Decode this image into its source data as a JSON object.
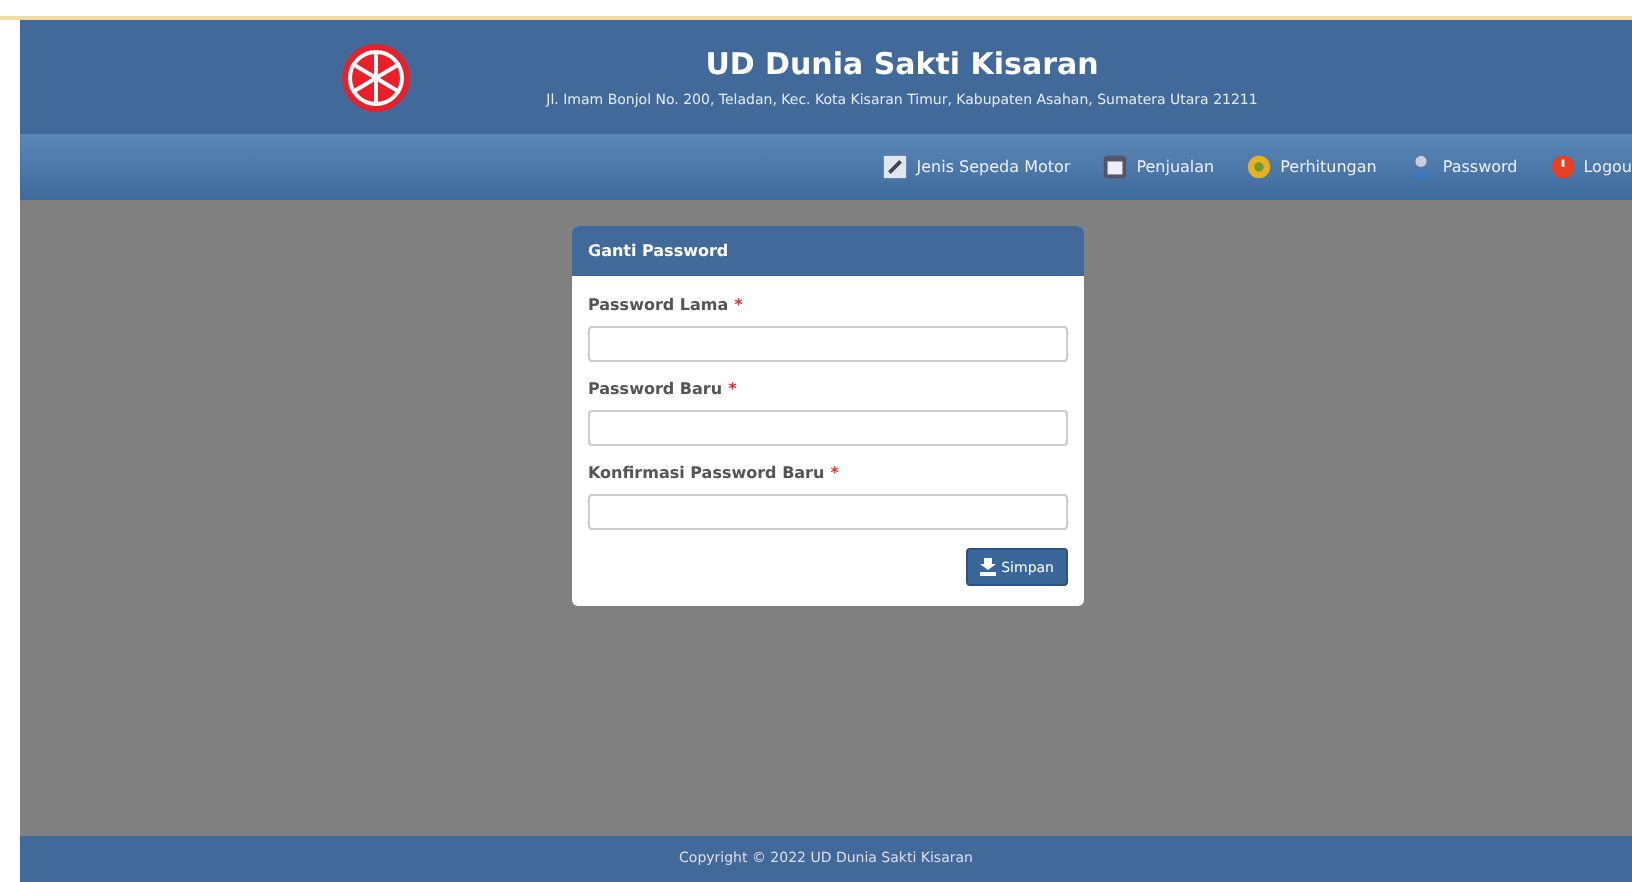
{
  "header": {
    "title": "UD Dunia Sakti Kisaran",
    "address": "Jl. Imam Bonjol No. 200, Teladan, Kec. Kota Kisaran Timur, Kabupaten Asahan, Sumatera Utara 21211"
  },
  "nav": [
    {
      "label": "Jenis Sepeda Motor",
      "kind": "edit"
    },
    {
      "label": "Penjualan",
      "kind": "calendar"
    },
    {
      "label": "Perhitungan",
      "kind": "gear"
    },
    {
      "label": "Password",
      "kind": "user"
    },
    {
      "label": "Logou",
      "kind": "power"
    }
  ],
  "panel": {
    "title": "Ganti Password",
    "fields": [
      {
        "label": "Password Lama",
        "required_mark": "*"
      },
      {
        "label": "Password Baru",
        "required_mark": "*"
      },
      {
        "label": "Konfirmasi Password Baru",
        "required_mark": "*"
      }
    ],
    "button": "Simpan"
  },
  "footer": "Copyright © 2022 UD Dunia Sakti Kisaran"
}
